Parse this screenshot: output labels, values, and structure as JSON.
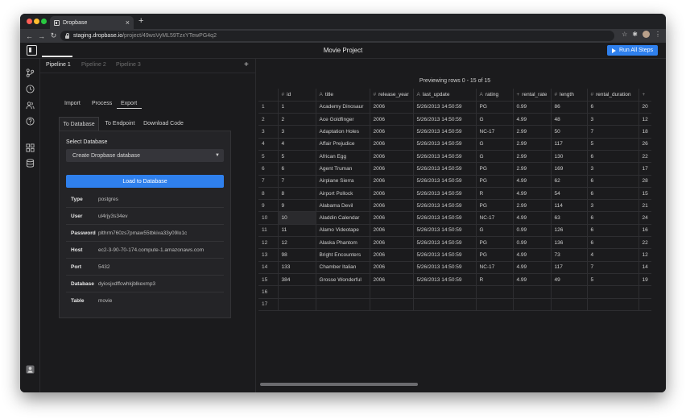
{
  "browser": {
    "tab_title": "Dropbase",
    "url_host": "staging.dropbase.io",
    "url_path": "/project/49wsVyML59TzxYTewPG4q2"
  },
  "app": {
    "project_title": "Movie Project",
    "run_all_label": "Run All Steps"
  },
  "sidebar": {
    "icons": [
      "branch-icon",
      "clock-icon",
      "users-icon",
      "help-icon",
      "grid-icon",
      "database-icon",
      "user-avatar-icon"
    ]
  },
  "pipelines": {
    "tabs": [
      "Pipeline 1",
      "Pipeline 2",
      "Pipeline 3"
    ],
    "active": "Pipeline 1"
  },
  "modes": {
    "tabs": [
      "Import",
      "Process",
      "Export"
    ],
    "active": "Export"
  },
  "export": {
    "sub_tabs": [
      "To Database",
      "To Endpoint",
      "Download Code"
    ],
    "active": "To Database",
    "select_label": "Select Database",
    "select_value": "Create Dropbase database",
    "load_label": "Load to Database",
    "fields": [
      {
        "key": "Type",
        "value": "postgres"
      },
      {
        "key": "User",
        "value": "ul4rjy3s34ev"
      },
      {
        "key": "Password",
        "value": "plthrm760zs7pmaw55tbkiva33y09lo1c"
      },
      {
        "key": "Host",
        "value": "ec2-3-90-70-174.compute-1.amazonaws.com"
      },
      {
        "key": "Port",
        "value": "5432"
      },
      {
        "key": "Database",
        "value": "dyiosjxdffcwhkjblkexmp3"
      },
      {
        "key": "Table",
        "value": "movie"
      }
    ]
  },
  "preview": {
    "title": "Previewing rows 0 - 15 of 15",
    "columns": [
      {
        "type": "#",
        "name": "id"
      },
      {
        "type": "A",
        "name": "title"
      },
      {
        "type": "#",
        "name": "release_year"
      },
      {
        "type": "A",
        "name": "last_update"
      },
      {
        "type": "A",
        "name": "rating"
      },
      {
        "type": "+",
        "name": "rental_rate"
      },
      {
        "type": "#",
        "name": "length"
      },
      {
        "type": "#",
        "name": "rental_duration"
      },
      {
        "type": "+",
        "name": ""
      }
    ],
    "rows": [
      [
        "1",
        "1",
        "Academy Dinosaur",
        "2006",
        "5/26/2013 14:50:59",
        "PG",
        "0.99",
        "86",
        "6",
        "20"
      ],
      [
        "2",
        "2",
        "Ace Goldfinger",
        "2006",
        "5/26/2013 14:50:59",
        "G",
        "4.99",
        "48",
        "3",
        "12"
      ],
      [
        "3",
        "3",
        "Adaptation Holes",
        "2006",
        "5/26/2013 14:50:59",
        "NC-17",
        "2.99",
        "50",
        "7",
        "18"
      ],
      [
        "4",
        "4",
        "Affair Prejudice",
        "2006",
        "5/26/2013 14:50:59",
        "G",
        "2.99",
        "117",
        "5",
        "26"
      ],
      [
        "5",
        "5",
        "African Egg",
        "2006",
        "5/26/2013 14:50:59",
        "G",
        "2.99",
        "130",
        "6",
        "22"
      ],
      [
        "6",
        "6",
        "Agent Truman",
        "2006",
        "5/26/2013 14:50:59",
        "PG",
        "2.99",
        "169",
        "3",
        "17"
      ],
      [
        "7",
        "7",
        "Airplane Sierra",
        "2006",
        "5/26/2013 14:50:59",
        "PG",
        "4.99",
        "62",
        "6",
        "28"
      ],
      [
        "8",
        "8",
        "Airport Pollock",
        "2006",
        "5/26/2013 14:50:59",
        "R",
        "4.99",
        "54",
        "6",
        "15"
      ],
      [
        "9",
        "9",
        "Alabama Devil",
        "2006",
        "5/26/2013 14:50:59",
        "PG",
        "2.99",
        "114",
        "3",
        "21"
      ],
      [
        "10",
        "10",
        "Aladdin Calendar",
        "2006",
        "5/26/2013 14:50:59",
        "NC-17",
        "4.99",
        "63",
        "6",
        "24"
      ],
      [
        "11",
        "11",
        "Alamo Videotape",
        "2006",
        "5/26/2013 14:50:59",
        "G",
        "0.99",
        "126",
        "6",
        "16"
      ],
      [
        "12",
        "12",
        "Alaska Phantom",
        "2006",
        "5/26/2013 14:50:59",
        "PG",
        "0.99",
        "136",
        "6",
        "22"
      ],
      [
        "13",
        "98",
        "Bright Encounters",
        "2006",
        "5/26/2013 14:50:59",
        "PG",
        "4.99",
        "73",
        "4",
        "12"
      ],
      [
        "14",
        "133",
        "Chamber Italian",
        "2006",
        "5/26/2013 14:50:59",
        "NC-17",
        "4.99",
        "117",
        "7",
        "14"
      ],
      [
        "15",
        "384",
        "Grosse Wonderful",
        "2006",
        "5/26/2013 14:50:59",
        "R",
        "4.99",
        "49",
        "5",
        "19"
      ],
      [
        "16",
        "",
        "",
        "",
        "",
        "",
        "",
        "",
        "",
        ""
      ],
      [
        "17",
        "",
        "",
        "",
        "",
        "",
        "",
        "",
        "",
        ""
      ]
    ]
  },
  "colors": {
    "accent": "#2f80ed",
    "background": "#1b1b1d",
    "panel": "#242427"
  }
}
